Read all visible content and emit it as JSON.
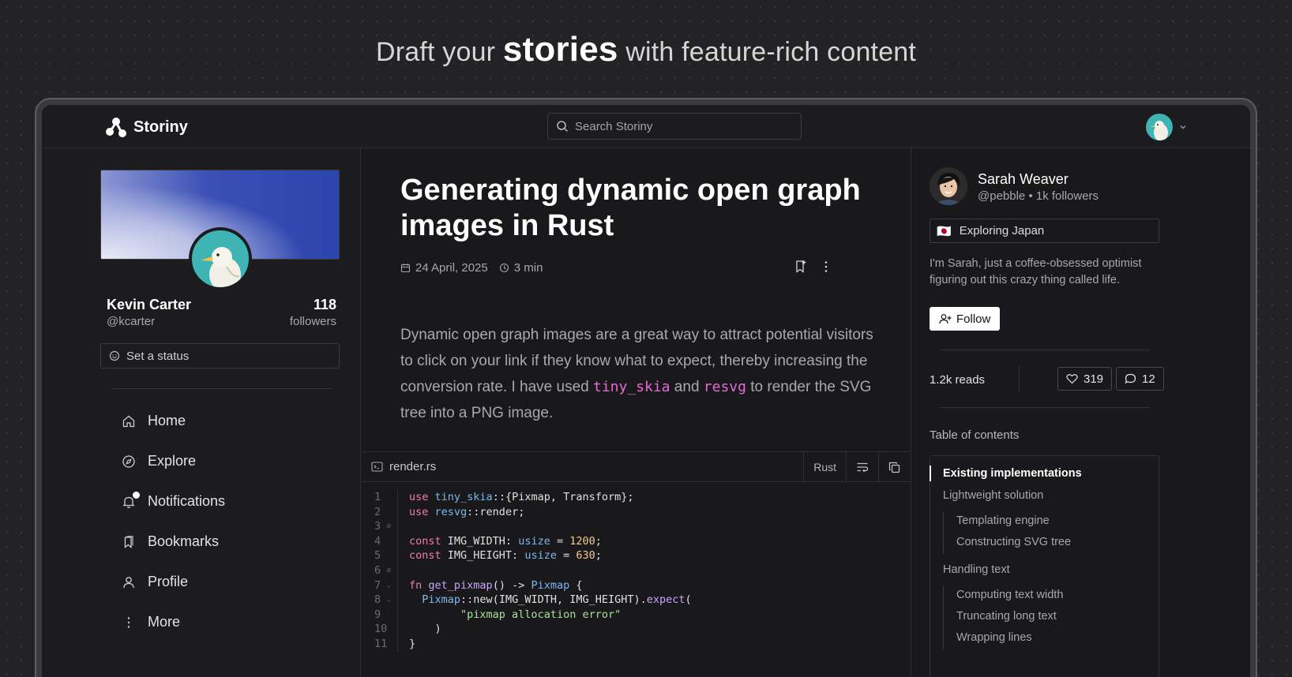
{
  "headline": {
    "pre": "Draft your",
    "bold": "stories",
    "post": "with feature-rich content"
  },
  "app": {
    "name": "Storiny"
  },
  "search": {
    "placeholder": "Search Storiny"
  },
  "profile": {
    "name": "Kevin Carter",
    "handle": "@kcarter",
    "followers_count": "118",
    "followers_label": "followers",
    "status_label": "Set a status"
  },
  "nav": {
    "items": [
      {
        "label": "Home",
        "icon": "home-icon"
      },
      {
        "label": "Explore",
        "icon": "compass-icon"
      },
      {
        "label": "Notifications",
        "icon": "bell-icon"
      },
      {
        "label": "Bookmarks",
        "icon": "bookmarks-icon"
      },
      {
        "label": "Profile",
        "icon": "user-icon"
      },
      {
        "label": "More",
        "icon": "more-vertical-icon"
      }
    ]
  },
  "story": {
    "title": "Generating dynamic open graph images in Rust",
    "date": "24 April, 2025",
    "read_time": "3 min",
    "body": {
      "p1": "Dynamic open graph images are a great way to attract potential visitors to click on your link if they know what to expect, thereby increasing the conversion rate. I have used ",
      "code1": "tiny_skia",
      "mid": " and ",
      "code2": "resvg",
      "p2": " to render the SVG tree into a PNG image."
    }
  },
  "code": {
    "filename": "render.rs",
    "language": "Rust",
    "line_numbers": [
      "1",
      "2",
      "3",
      "4",
      "5",
      "6",
      "7",
      "8",
      "9",
      "10",
      "11"
    ]
  },
  "author": {
    "name": "Sarah Weaver",
    "handle_followers": "@pebble • 1k followers",
    "status_emoji": "🇯🇵",
    "status": "Exploring Japan",
    "bio": "I'm Sarah, just a coffee-obsessed optimist figuring out this crazy thing called life.",
    "follow_label": "Follow"
  },
  "stats": {
    "reads": "1.2k reads",
    "likes": "319",
    "comments": "12"
  },
  "toc": {
    "title": "Table of contents",
    "items": [
      "Existing implementations",
      "Lightweight solution",
      "Templating engine",
      "Constructing SVG tree",
      "Handling text",
      "Computing text width",
      "Truncating long text",
      "Wrapping lines"
    ]
  },
  "colors": {
    "accent_code": "#e46ad6",
    "background": "#232325",
    "panel": "#19191b"
  }
}
